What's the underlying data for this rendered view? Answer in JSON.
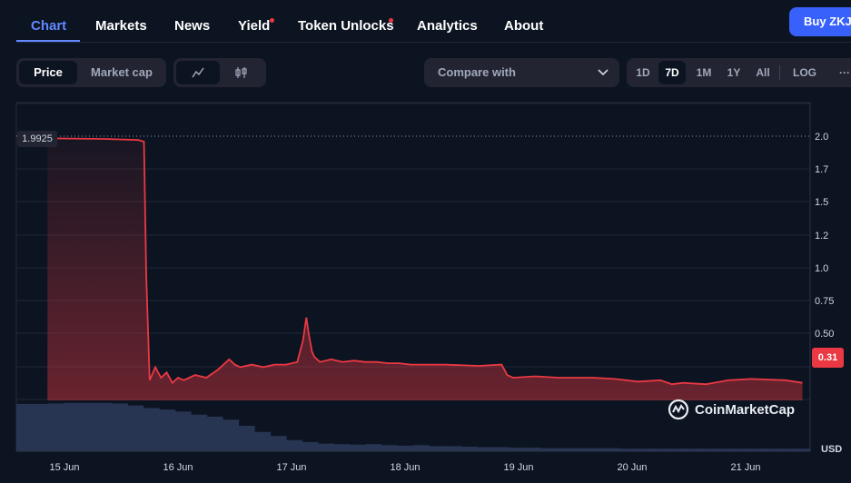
{
  "nav": {
    "tabs": [
      {
        "label": "Chart",
        "active": true
      },
      {
        "label": "Markets"
      },
      {
        "label": "News"
      },
      {
        "label": "Yield",
        "dot": true
      },
      {
        "label": "Token Unlocks",
        "dot": true
      },
      {
        "label": "Analytics"
      },
      {
        "label": "About"
      }
    ],
    "buy_label": "Buy ZKJ"
  },
  "toolbar": {
    "metric_options": [
      "Price",
      "Market cap"
    ],
    "metric_selected": "Price",
    "compare_label": "Compare with",
    "ranges": [
      "1D",
      "7D",
      "1M",
      "1Y",
      "All"
    ],
    "range_selected": "7D",
    "log_label": "LOG",
    "more_label": "···"
  },
  "chart_data": {
    "type": "line",
    "y_ticks": [
      "2.0",
      "1.7",
      "1.5",
      "1.2",
      "1.0",
      "0.75",
      "0.50"
    ],
    "x_ticks": [
      "15 Jun",
      "16 Jun",
      "17 Jun",
      "18 Jun",
      "19 Jun",
      "20 Jun",
      "21 Jun"
    ],
    "start_value": "1.9925",
    "current_value": "0.31",
    "currency_label": "USD",
    "line_color": "#ea3943",
    "x": [
      0,
      0.5,
      0.8,
      0.85,
      0.87,
      0.9,
      0.95,
      1.0,
      1.05,
      1.1,
      1.15,
      1.2,
      1.25,
      1.3,
      1.4,
      1.5,
      1.6,
      1.65,
      1.7,
      1.8,
      1.9,
      2.0,
      2.1,
      2.2,
      2.25,
      2.28,
      2.3,
      2.33,
      2.35,
      2.4,
      2.5,
      2.6,
      2.7,
      2.8,
      2.9,
      3.0,
      3.1,
      3.2,
      3.3,
      3.5,
      3.8,
      4.0,
      4.05,
      4.1,
      4.3,
      4.5,
      4.8,
      5.0,
      5.2,
      5.4,
      5.5,
      5.6,
      5.8,
      6.0,
      6.2,
      6.5,
      6.65
    ],
    "values": [
      1.98,
      1.975,
      1.965,
      1.95,
      0.95,
      0.32,
      0.37,
      0.33,
      0.35,
      0.31,
      0.33,
      0.32,
      0.33,
      0.34,
      0.33,
      0.36,
      0.4,
      0.38,
      0.37,
      0.38,
      0.37,
      0.38,
      0.38,
      0.39,
      0.47,
      0.62,
      0.5,
      0.43,
      0.41,
      0.39,
      0.4,
      0.39,
      0.395,
      0.39,
      0.39,
      0.385,
      0.385,
      0.38,
      0.38,
      0.38,
      0.375,
      0.38,
      0.34,
      0.33,
      0.335,
      0.33,
      0.33,
      0.325,
      0.315,
      0.32,
      0.305,
      0.31,
      0.305,
      0.32,
      0.325,
      0.32,
      0.31
    ],
    "volume": [
      0.93,
      0.93,
      0.94,
      0.95,
      0.95,
      0.95,
      0.94,
      0.9,
      0.85,
      0.82,
      0.78,
      0.72,
      0.68,
      0.62,
      0.5,
      0.38,
      0.3,
      0.22,
      0.18,
      0.15,
      0.14,
      0.13,
      0.14,
      0.12,
      0.11,
      0.12,
      0.1,
      0.1,
      0.09,
      0.08,
      0.08,
      0.07,
      0.07,
      0.06,
      0.06,
      0.06,
      0.06,
      0.06,
      0.05,
      0.05,
      0.05,
      0.05,
      0.05,
      0.05,
      0.05,
      0.05,
      0.05,
      0.05,
      0.05,
      0.05
    ]
  },
  "watermark": "CoinMarketCap"
}
